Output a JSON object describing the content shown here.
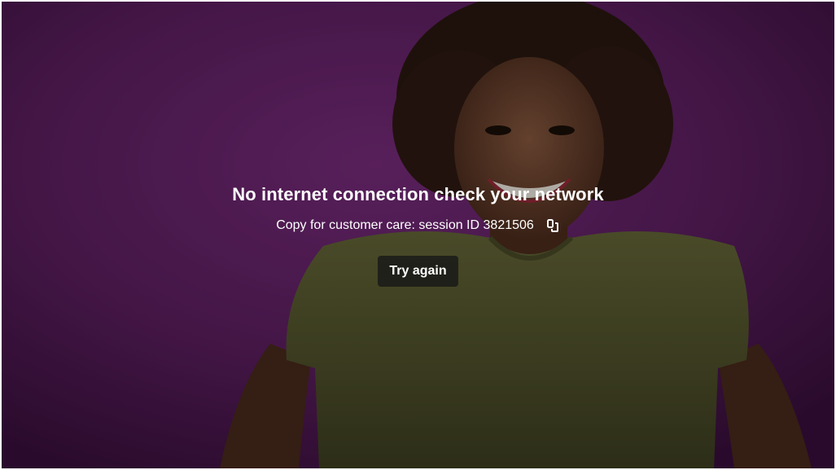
{
  "error": {
    "title": "No internet connection check your network",
    "session_prefix": "Copy for customer care: session ID",
    "session_id": "3821506",
    "retry_label": "Try again",
    "copy_icon": "copy-icon"
  },
  "colors": {
    "background_purple": "#5e1f62",
    "shirt_olive": "#55562f",
    "button_background": "#1c1c1c",
    "text": "#ffffff"
  }
}
